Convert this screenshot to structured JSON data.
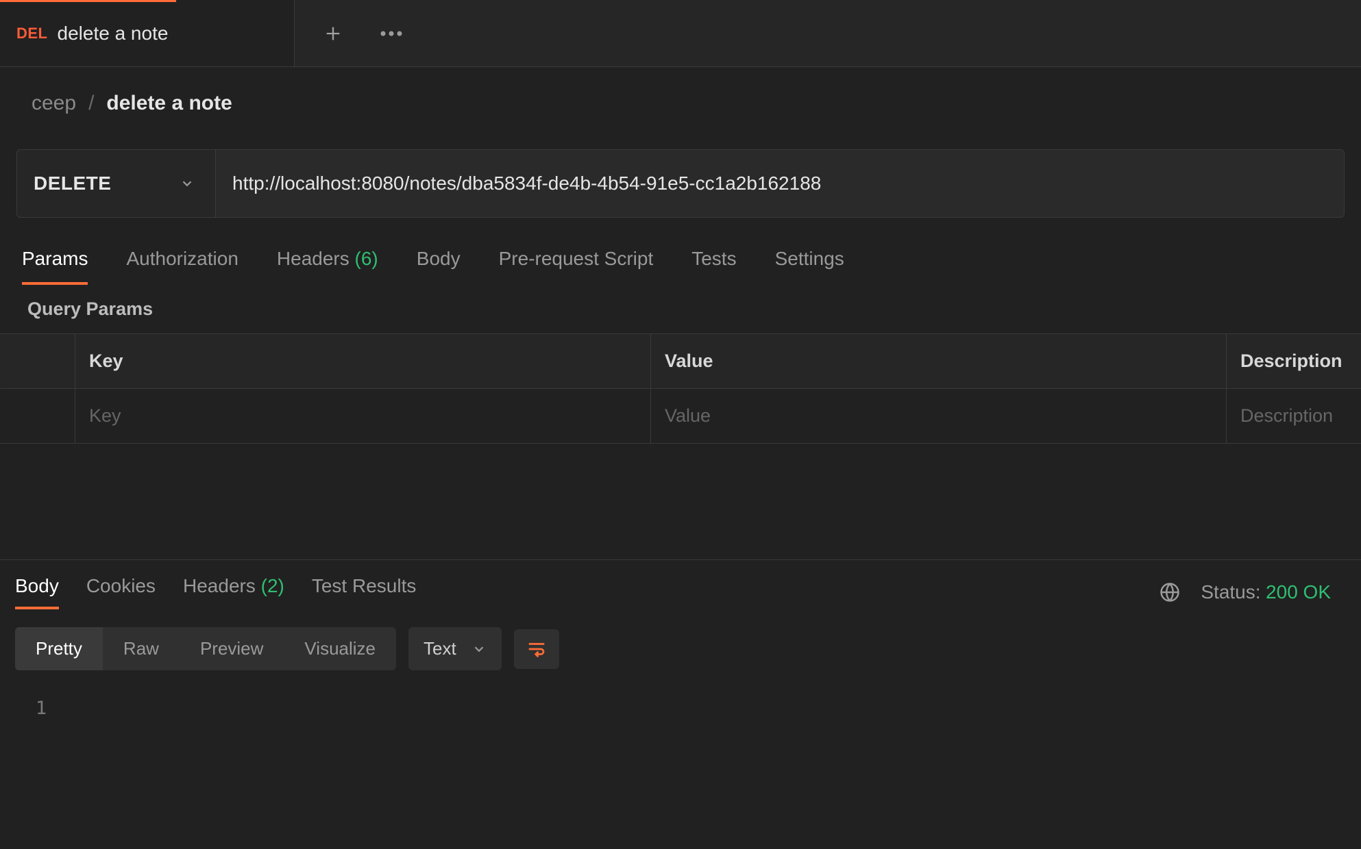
{
  "tabBar": {
    "tabs": [
      {
        "methodBadge": "DEL",
        "title": "delete a note",
        "active": true
      }
    ]
  },
  "breadcrumb": {
    "collection": "ceep",
    "separator": "/",
    "request": "delete a note"
  },
  "request": {
    "method": "DELETE",
    "url": "http://localhost:8080/notes/dba5834f-de4b-4b54-91e5-cc1a2b162188"
  },
  "requestTabs": {
    "items": [
      {
        "label": "Params",
        "active": true
      },
      {
        "label": "Authorization"
      },
      {
        "label": "Headers",
        "count": "(6)"
      },
      {
        "label": "Body"
      },
      {
        "label": "Pre-request Script"
      },
      {
        "label": "Tests"
      },
      {
        "label": "Settings"
      }
    ]
  },
  "paramsSection": {
    "title": "Query Params",
    "columns": {
      "key": "Key",
      "value": "Value",
      "description": "Description"
    },
    "placeholders": {
      "key": "Key",
      "value": "Value",
      "description": "Description"
    }
  },
  "responseTabs": {
    "items": [
      {
        "label": "Body",
        "active": true
      },
      {
        "label": "Cookies"
      },
      {
        "label": "Headers",
        "count": "(2)"
      },
      {
        "label": "Test Results"
      }
    ]
  },
  "responseStatus": {
    "label": "Status:",
    "code": "200 OK"
  },
  "bodyView": {
    "modes": [
      {
        "label": "Pretty",
        "active": true
      },
      {
        "label": "Raw"
      },
      {
        "label": "Preview"
      },
      {
        "label": "Visualize"
      }
    ],
    "format": "Text",
    "lines": [
      {
        "num": "1",
        "text": ""
      }
    ]
  }
}
